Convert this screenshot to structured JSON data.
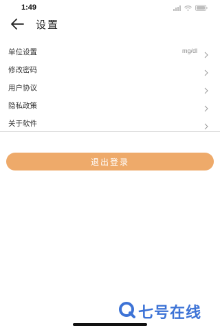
{
  "status_bar": {
    "time": "1:49"
  },
  "header": {
    "title": "设置"
  },
  "menu": {
    "items": [
      {
        "label": "单位设置",
        "value": "mg/dl"
      },
      {
        "label": "修改密码"
      },
      {
        "label": "用户协议"
      },
      {
        "label": "隐私政策"
      },
      {
        "label": "关于软件"
      }
    ]
  },
  "logout": {
    "label": "退出登录"
  },
  "watermark": {
    "text": "七号在线"
  },
  "colors": {
    "accent": "#eeaa6a",
    "watermark": "#3d73d6"
  }
}
